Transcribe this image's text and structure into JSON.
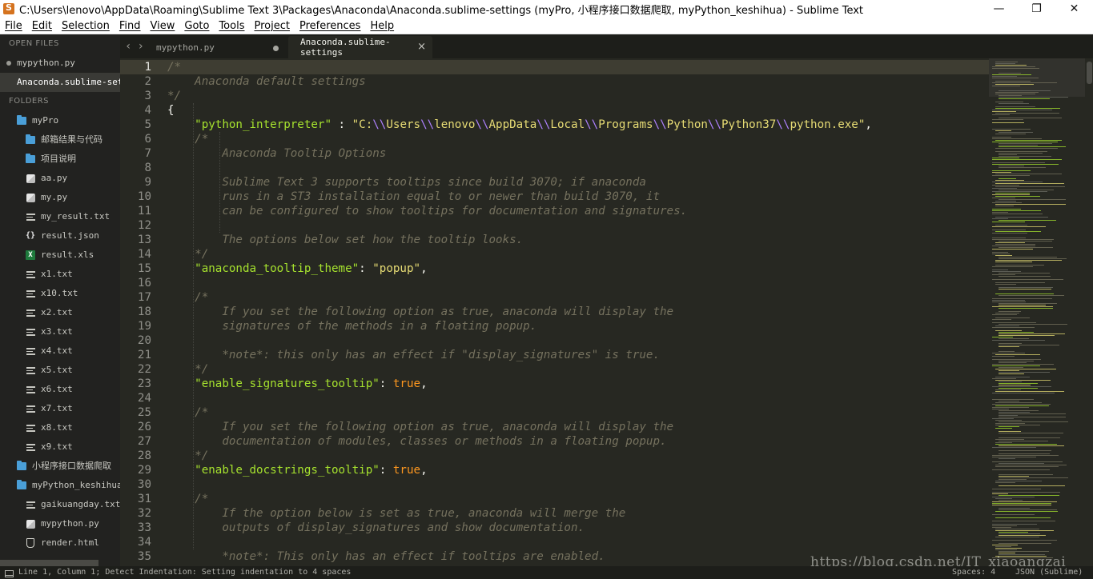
{
  "window": {
    "title": "C:\\Users\\lenovo\\AppData\\Roaming\\Sublime Text 3\\Packages\\Anaconda\\Anaconda.sublime-settings (myPro, 小程序接口数据爬取, myPython_keshihua) - Sublime Text",
    "controls": {
      "minimize": "—",
      "restore": "❐",
      "close": "✕"
    }
  },
  "menu": [
    "File",
    "Edit",
    "Selection",
    "Find",
    "View",
    "Goto",
    "Tools",
    "Project",
    "Preferences",
    "Help"
  ],
  "sidebar": {
    "open_files_header": "OPEN FILES",
    "open_files": [
      {
        "label": "mypython.py",
        "modified": true
      },
      {
        "label": "Anaconda.sublime-settings",
        "active": true
      }
    ],
    "folders_header": "FOLDERS",
    "tree": [
      {
        "label": "myPro",
        "type": "folder",
        "depth": 0
      },
      {
        "label": "邮箱结果与代码",
        "type": "folder",
        "depth": 1
      },
      {
        "label": "项目说明",
        "type": "folder",
        "depth": 1
      },
      {
        "label": "aa.py",
        "type": "py",
        "depth": 1
      },
      {
        "label": "my.py",
        "type": "py",
        "depth": 1
      },
      {
        "label": "my_result.txt",
        "type": "txt",
        "depth": 1
      },
      {
        "label": "result.json",
        "type": "json",
        "depth": 1
      },
      {
        "label": "result.xls",
        "type": "xls",
        "depth": 1
      },
      {
        "label": "x1.txt",
        "type": "txt",
        "depth": 1
      },
      {
        "label": "x10.txt",
        "type": "txt",
        "depth": 1
      },
      {
        "label": "x2.txt",
        "type": "txt",
        "depth": 1
      },
      {
        "label": "x3.txt",
        "type": "txt",
        "depth": 1
      },
      {
        "label": "x4.txt",
        "type": "txt",
        "depth": 1
      },
      {
        "label": "x5.txt",
        "type": "txt",
        "depth": 1
      },
      {
        "label": "x6.txt",
        "type": "txt",
        "depth": 1
      },
      {
        "label": "x7.txt",
        "type": "txt",
        "depth": 1
      },
      {
        "label": "x8.txt",
        "type": "txt",
        "depth": 1
      },
      {
        "label": "x9.txt",
        "type": "txt",
        "depth": 1
      },
      {
        "label": "小程序接口数据爬取",
        "type": "folder",
        "depth": 0
      },
      {
        "label": "myPython_keshihua",
        "type": "folder",
        "depth": 0
      },
      {
        "label": "gaikuangday.txt",
        "type": "txt",
        "depth": 1
      },
      {
        "label": "mypython.py",
        "type": "py",
        "depth": 1
      },
      {
        "label": "render.html",
        "type": "html",
        "depth": 1
      }
    ]
  },
  "tabs": [
    {
      "label": "mypython.py",
      "active": false,
      "modified": true
    },
    {
      "label": "Anaconda.sublime-settings",
      "active": true
    }
  ],
  "editor": {
    "current_line": 1,
    "lines": [
      {
        "n": 1,
        "tokens": [
          {
            "t": "c",
            "v": "/*"
          }
        ]
      },
      {
        "n": 2,
        "tokens": [
          {
            "t": "c",
            "v": "    Anaconda default settings"
          }
        ]
      },
      {
        "n": 3,
        "tokens": [
          {
            "t": "c",
            "v": "*/"
          }
        ]
      },
      {
        "n": 4,
        "tokens": [
          {
            "t": "p",
            "v": "{"
          }
        ]
      },
      {
        "n": 5,
        "tokens": [
          {
            "t": "p",
            "v": "    "
          },
          {
            "t": "k",
            "v": "\"python_interpreter\""
          },
          {
            "t": "p",
            "v": " : "
          },
          {
            "t": "s",
            "v": "\"C:"
          },
          {
            "t": "e",
            "v": "\\\\"
          },
          {
            "t": "s",
            "v": "Users"
          },
          {
            "t": "e",
            "v": "\\\\"
          },
          {
            "t": "s",
            "v": "lenovo"
          },
          {
            "t": "e",
            "v": "\\\\"
          },
          {
            "t": "s",
            "v": "AppData"
          },
          {
            "t": "e",
            "v": "\\\\"
          },
          {
            "t": "s",
            "v": "Local"
          },
          {
            "t": "e",
            "v": "\\\\"
          },
          {
            "t": "s",
            "v": "Programs"
          },
          {
            "t": "e",
            "v": "\\\\"
          },
          {
            "t": "s",
            "v": "Python"
          },
          {
            "t": "e",
            "v": "\\\\"
          },
          {
            "t": "s",
            "v": "Python37"
          },
          {
            "t": "e",
            "v": "\\\\"
          },
          {
            "t": "s",
            "v": "python.exe\""
          },
          {
            "t": "p",
            "v": ","
          }
        ]
      },
      {
        "n": 6,
        "tokens": [
          {
            "t": "c",
            "v": "    /*"
          }
        ]
      },
      {
        "n": 7,
        "tokens": [
          {
            "t": "c",
            "v": "        Anaconda Tooltip Options"
          }
        ]
      },
      {
        "n": 8,
        "tokens": []
      },
      {
        "n": 9,
        "tokens": [
          {
            "t": "c",
            "v": "        Sublime Text 3 supports tooltips since build 3070; if anaconda"
          }
        ]
      },
      {
        "n": 10,
        "tokens": [
          {
            "t": "c",
            "v": "        runs in a ST3 installation equal to or newer than build 3070, it"
          }
        ]
      },
      {
        "n": 11,
        "tokens": [
          {
            "t": "c",
            "v": "        can be configured to show tooltips for documentation and signatures."
          }
        ]
      },
      {
        "n": 12,
        "tokens": []
      },
      {
        "n": 13,
        "tokens": [
          {
            "t": "c",
            "v": "        The options below set how the tooltip looks."
          }
        ]
      },
      {
        "n": 14,
        "tokens": [
          {
            "t": "c",
            "v": "    */"
          }
        ]
      },
      {
        "n": 15,
        "tokens": [
          {
            "t": "p",
            "v": "    "
          },
          {
            "t": "k",
            "v": "\"anaconda_tooltip_theme\""
          },
          {
            "t": "p",
            "v": ": "
          },
          {
            "t": "s",
            "v": "\"popup\""
          },
          {
            "t": "p",
            "v": ","
          }
        ]
      },
      {
        "n": 16,
        "tokens": []
      },
      {
        "n": 17,
        "tokens": [
          {
            "t": "c",
            "v": "    /*"
          }
        ]
      },
      {
        "n": 18,
        "tokens": [
          {
            "t": "c",
            "v": "        If you set the following option as true, anaconda will display the"
          }
        ]
      },
      {
        "n": 19,
        "tokens": [
          {
            "t": "c",
            "v": "        signatures of the methods in a floating popup."
          }
        ]
      },
      {
        "n": 20,
        "tokens": []
      },
      {
        "n": 21,
        "tokens": [
          {
            "t": "c",
            "v": "        *note*: this only has an effect if \"display_signatures\" is true."
          }
        ]
      },
      {
        "n": 22,
        "tokens": [
          {
            "t": "c",
            "v": "    */"
          }
        ]
      },
      {
        "n": 23,
        "tokens": [
          {
            "t": "p",
            "v": "    "
          },
          {
            "t": "k",
            "v": "\"enable_signatures_tooltip\""
          },
          {
            "t": "p",
            "v": ": "
          },
          {
            "t": "b",
            "v": "true"
          },
          {
            "t": "p",
            "v": ","
          }
        ]
      },
      {
        "n": 24,
        "tokens": []
      },
      {
        "n": 25,
        "tokens": [
          {
            "t": "c",
            "v": "    /*"
          }
        ]
      },
      {
        "n": 26,
        "tokens": [
          {
            "t": "c",
            "v": "        If you set the following option as true, anaconda will display the"
          }
        ]
      },
      {
        "n": 27,
        "tokens": [
          {
            "t": "c",
            "v": "        documentation of modules, classes or methods in a floating popup."
          }
        ]
      },
      {
        "n": 28,
        "tokens": [
          {
            "t": "c",
            "v": "    */"
          }
        ]
      },
      {
        "n": 29,
        "tokens": [
          {
            "t": "p",
            "v": "    "
          },
          {
            "t": "k",
            "v": "\"enable_docstrings_tooltip\""
          },
          {
            "t": "p",
            "v": ": "
          },
          {
            "t": "b",
            "v": "true"
          },
          {
            "t": "p",
            "v": ","
          }
        ]
      },
      {
        "n": 30,
        "tokens": []
      },
      {
        "n": 31,
        "tokens": [
          {
            "t": "c",
            "v": "    /*"
          }
        ]
      },
      {
        "n": 32,
        "tokens": [
          {
            "t": "c",
            "v": "        If the option below is set as true, anaconda will merge the"
          }
        ]
      },
      {
        "n": 33,
        "tokens": [
          {
            "t": "c",
            "v": "        outputs of display_signatures and show documentation."
          }
        ]
      },
      {
        "n": 34,
        "tokens": []
      },
      {
        "n": 35,
        "tokens": [
          {
            "t": "c",
            "v": "        *note*: This only has an effect if tooltips are enabled."
          }
        ]
      }
    ]
  },
  "status": {
    "left": "Line 1, Column 1; Detect Indentation: Setting indentation to 4 spaces",
    "spaces": "Spaces: 4",
    "syntax": "JSON (Sublime)"
  },
  "watermark": "https://blog.csdn.net/IT_xiaoangzai",
  "colors": {
    "background": "#272822",
    "comment": "#75715e",
    "key": "#a6e22e",
    "string": "#e6db74",
    "escape": "#ae81ff",
    "constant": "#fd971f",
    "sidebar": "#222220"
  }
}
